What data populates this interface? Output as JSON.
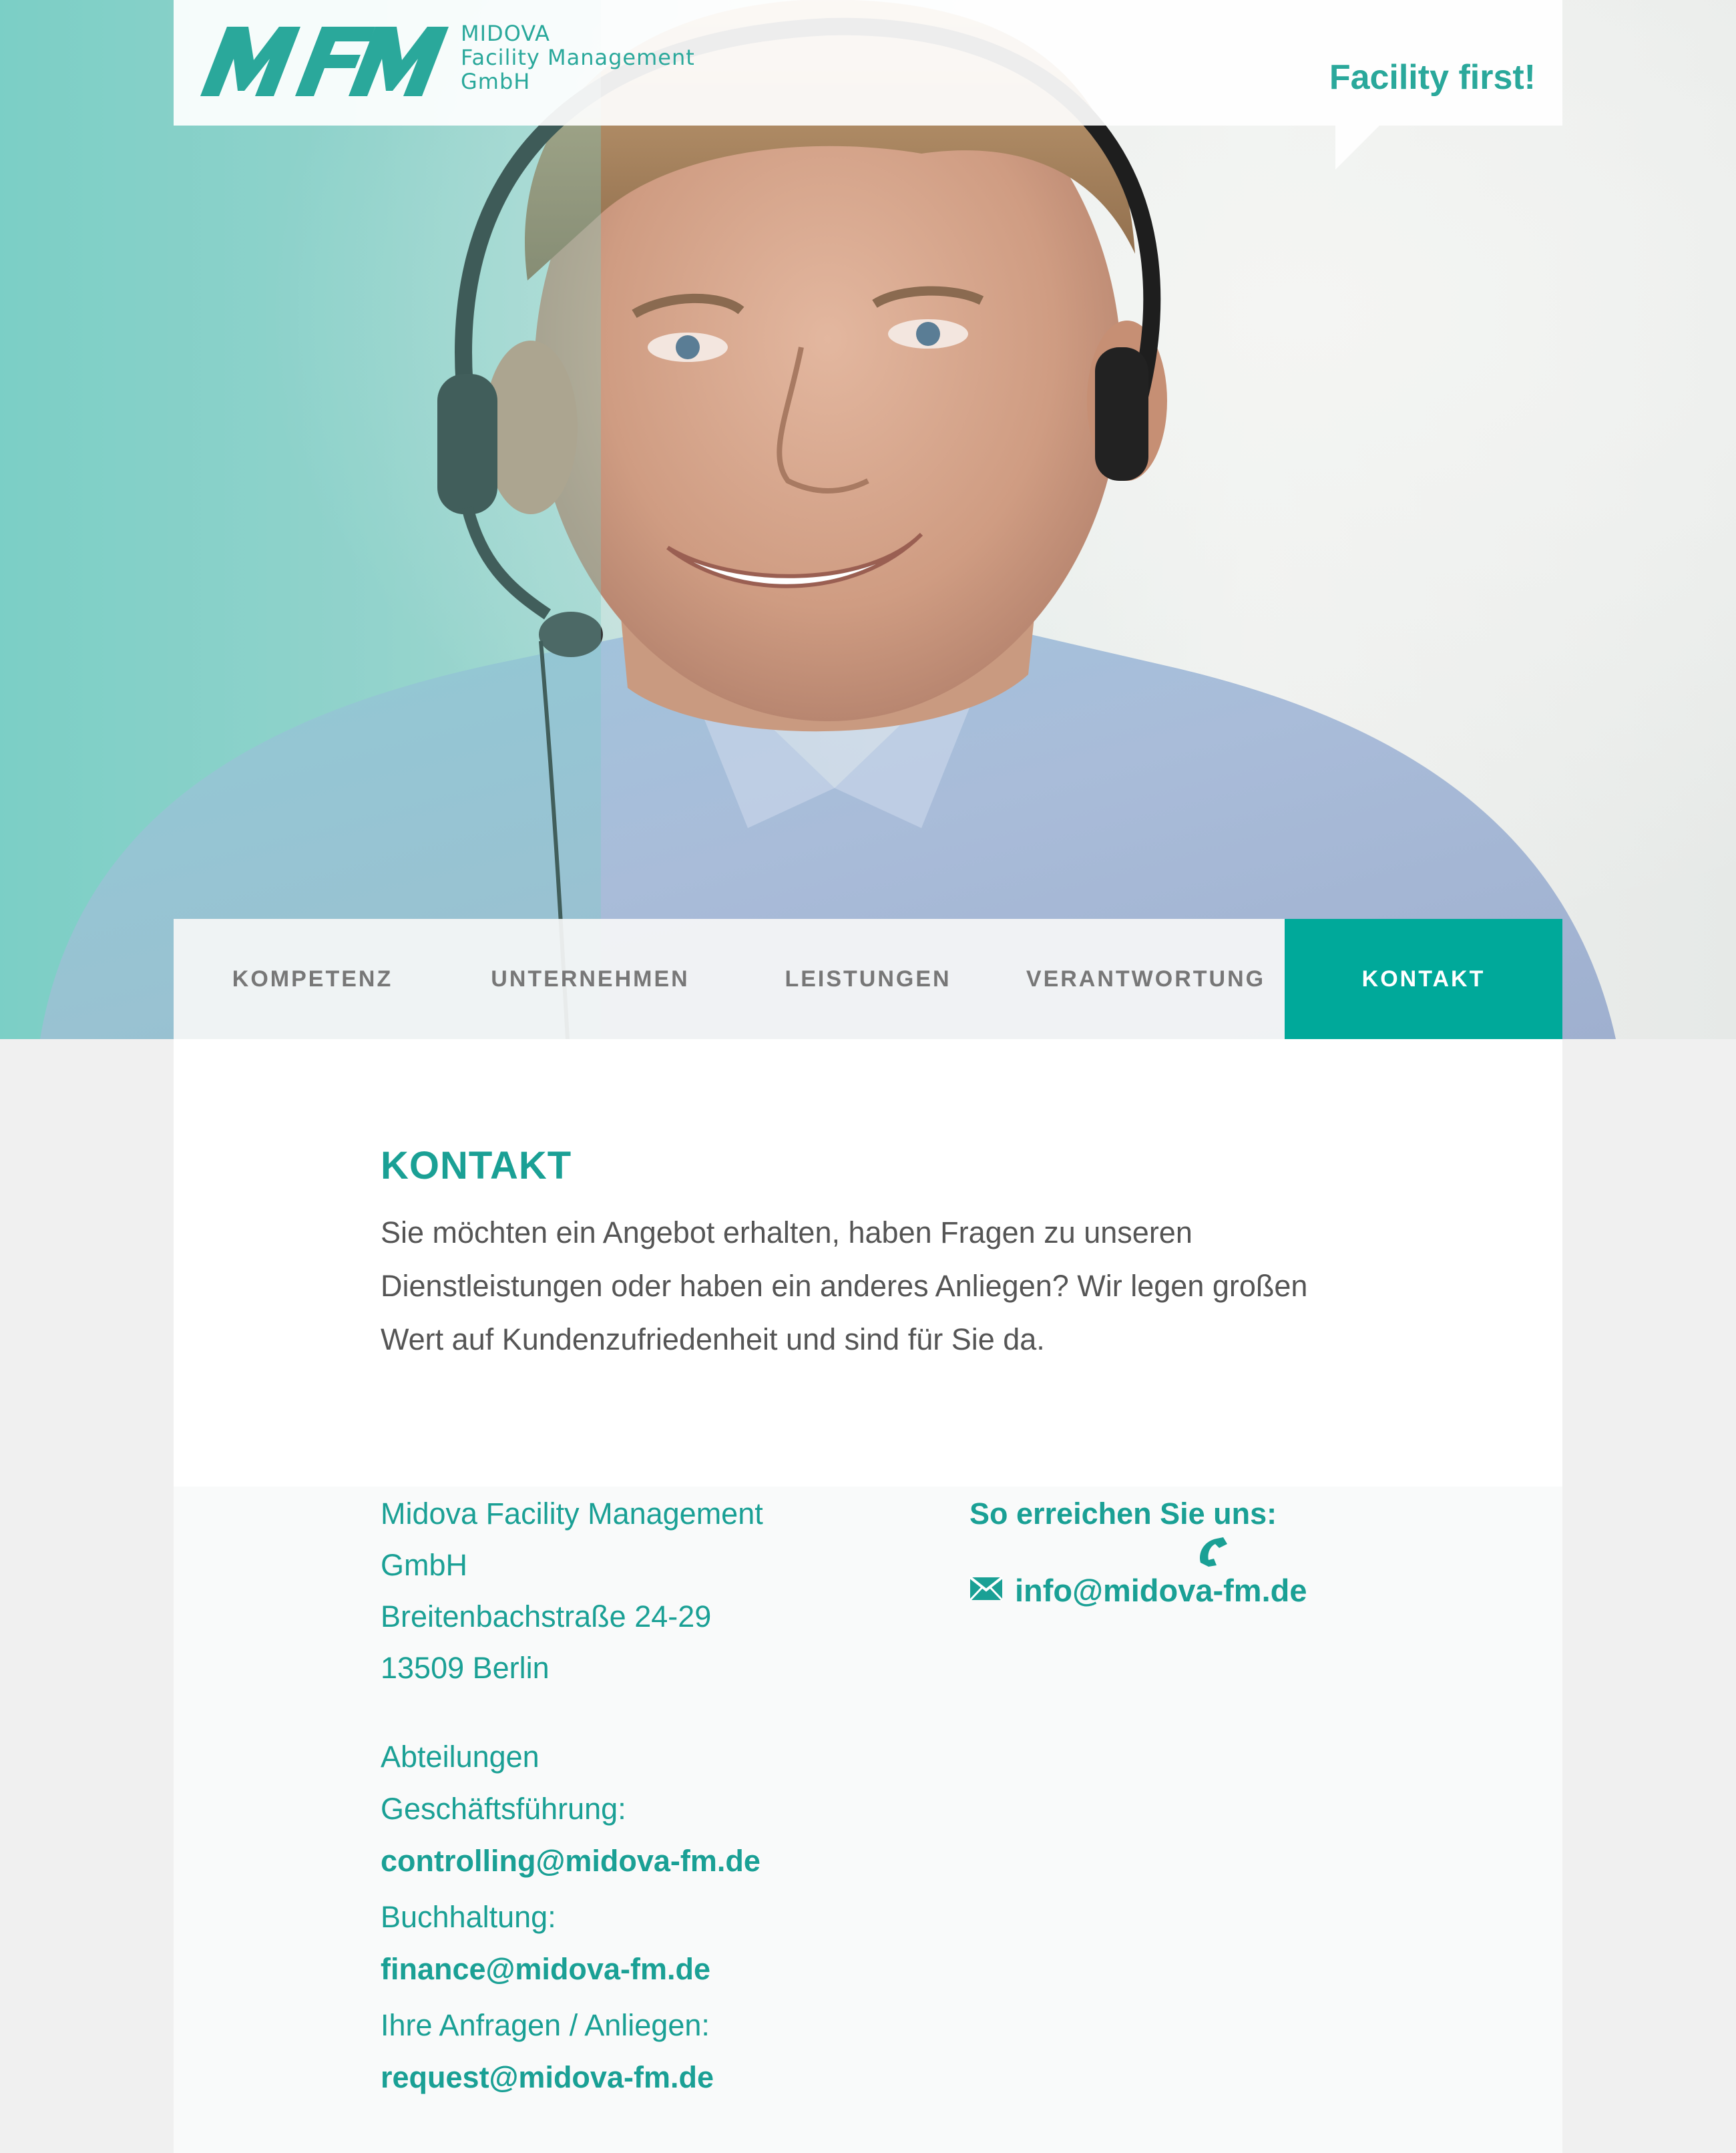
{
  "brand": {
    "logo_mark": "MFM",
    "name_line1": "MIDOVA",
    "name_line2": "Facility Management",
    "name_line3": "GmbH",
    "slogan": "Facility first!",
    "color_primary": "#00a99a",
    "color_text": "#1aa095"
  },
  "hero": {
    "image_subject": "smiling man wearing a headset",
    "icon": "photo"
  },
  "nav": {
    "items": [
      {
        "label": "KOMPETENZ"
      },
      {
        "label": "UNTERNEHMEN"
      },
      {
        "label": "LEISTUNGEN"
      },
      {
        "label": "VERANTWORTUNG"
      },
      {
        "label": "KONTAKT"
      }
    ],
    "active": "KONTAKT"
  },
  "contact": {
    "title": "KONTAKT",
    "intro": "Sie möchten ein Angebot erhalten, haben Fragen zu unseren Dienstleistungen oder haben ein anderes Anliegen? Wir legen großen Wert auf Kundenzufriedenheit und sind für Sie da.",
    "address": {
      "line1": "Midova Facility Management",
      "line2": "GmbH",
      "line3": "Breitenbachstraße 24-29",
      "line4": "13509 Berlin"
    },
    "departments": {
      "title": "Abteilungen",
      "items": [
        {
          "label": "Geschäftsführung:",
          "email": "controlling@midova-fm.de"
        },
        {
          "label": "Buchhaltung:",
          "email": "finance@midova-fm.de"
        },
        {
          "label": "Ihre Anfragen / Anliegen:",
          "email": "request@midova-fm.de"
        }
      ]
    },
    "reach": {
      "title": "So erreichen Sie uns:",
      "phone_icon": "phone-icon",
      "mail_icon": "envelope-icon",
      "email": "info@midova-fm.de"
    }
  }
}
